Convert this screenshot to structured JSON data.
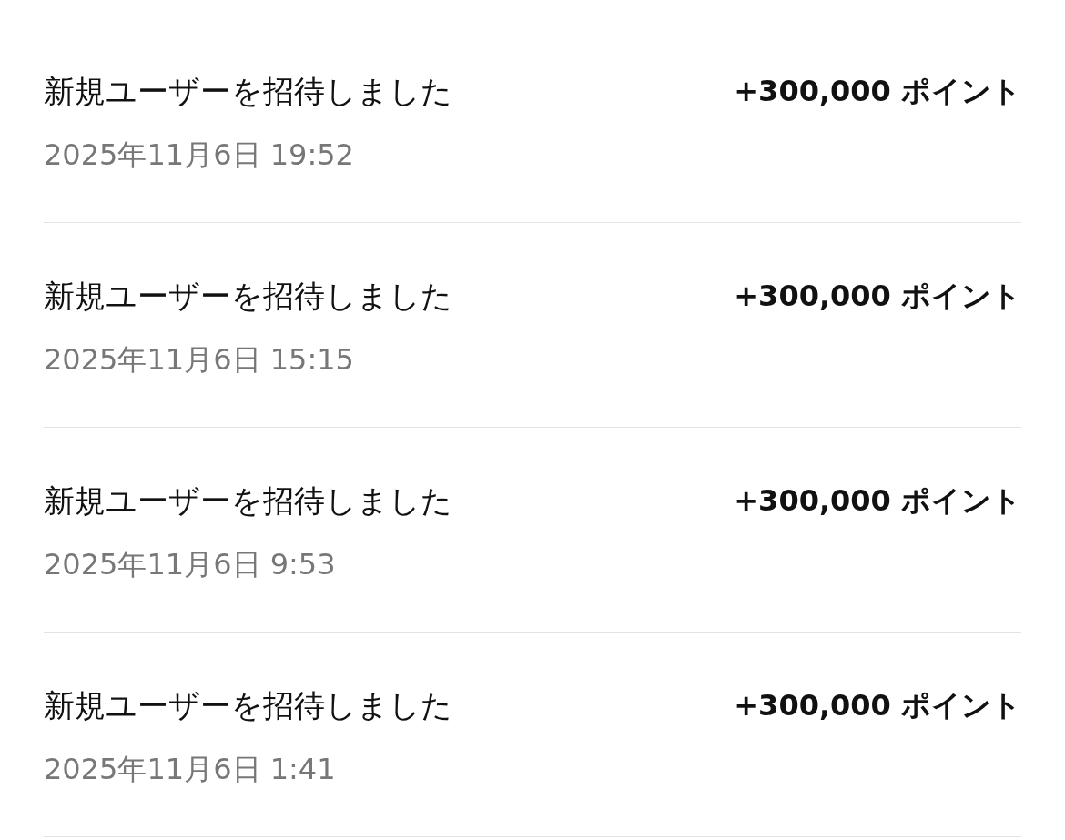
{
  "history": [
    {
      "title": "新規ユーザーを招待しました",
      "date": "2025年11月6日 19:52",
      "points": "+300,000 ポイント"
    },
    {
      "title": "新規ユーザーを招待しました",
      "date": "2025年11月6日 15:15",
      "points": "+300,000 ポイント"
    },
    {
      "title": "新規ユーザーを招待しました",
      "date": "2025年11月6日 9:53",
      "points": "+300,000 ポイント"
    },
    {
      "title": "新規ユーザーを招待しました",
      "date": "2025年11月6日 1:41",
      "points": "+300,000 ポイント"
    }
  ]
}
